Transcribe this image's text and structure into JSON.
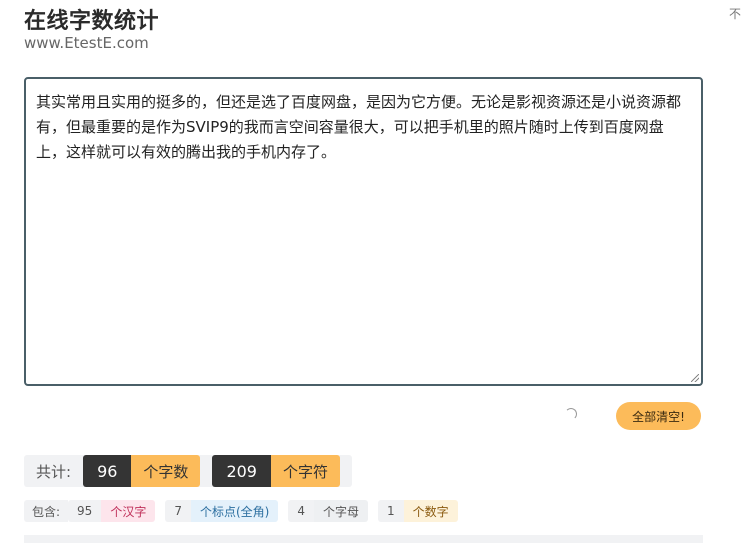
{
  "header": {
    "title": "在线字数统计",
    "subtitle": "www.EtestE.com",
    "corner_text": "不"
  },
  "editor": {
    "text": "其实常用且实用的挺多的，但还是选了百度网盘，是因为它方便。无论是影视资源还是小说资源都有，但最重要的是作为SVIP9的我而言空间容量很大，可以把手机里的照片随时上传到百度网盘上，这样就可以有效的腾出我的手机内存了。"
  },
  "actions": {
    "clear_label": "全部清空!"
  },
  "summary": {
    "label": "共计:",
    "word_count": "96",
    "word_unit": "个字数",
    "char_count": "209",
    "char_unit": "个字符"
  },
  "detail": {
    "label": "包含:",
    "chinese": {
      "count": "95",
      "unit": "个汉字"
    },
    "punctuation": {
      "count": "7",
      "unit": "个标点(全角)"
    },
    "letters": {
      "count": "4",
      "unit": "个字母"
    },
    "digits": {
      "count": "1",
      "unit": "个数字"
    }
  },
  "colors": {
    "accent": "#fcbb5a",
    "dark": "#343434",
    "editor_border": "#4a5f68"
  }
}
